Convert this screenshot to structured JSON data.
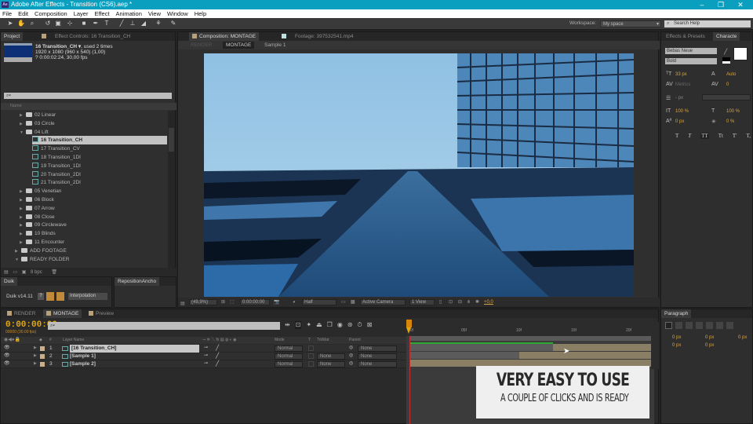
{
  "window": {
    "app_icon": "Ae",
    "title": "Adobe After Effects - Transition (CS6).aep *",
    "controls": {
      "minimize": "–",
      "restore": "❐",
      "close": "✕"
    }
  },
  "menu": [
    "File",
    "Edit",
    "Composition",
    "Layer",
    "Effect",
    "Animation",
    "View",
    "Window",
    "Help"
  ],
  "toolbar": {
    "tools": [
      "selection-tool",
      "hand-tool",
      "zoom-tool",
      "rotate-tool",
      "camera-tool",
      "pan-behind-tool",
      "mask-tool",
      "pen-tool",
      "type-tool",
      "brush-tool",
      "clone-stamp-tool",
      "eraser-tool",
      "roto-brush-tool",
      "puppet-pin-tool"
    ],
    "workspace_label": "Workspace:",
    "workspace_value": "My space",
    "search_placeholder": "Search Help"
  },
  "project": {
    "tabs": [
      "Project",
      "Effect Controls: 16 Transition_CH"
    ],
    "selected_item": {
      "name": "16 Transition_CH ▾",
      "usage": ", used 2 times",
      "resolution": "1920 x 1080  (960 x 540) (1,00)",
      "duration": "? 0:00:02:24, 30,00 fps"
    },
    "search_placeholder": "⌕▾",
    "column_header": "Name",
    "items": [
      {
        "label": "02 Linear",
        "type": "folder",
        "indent": 2,
        "expanded": false
      },
      {
        "label": "03 Circle",
        "type": "folder",
        "indent": 2,
        "expanded": false
      },
      {
        "label": "04 Lift",
        "type": "folder",
        "indent": 2,
        "expanded": true
      },
      {
        "label": "16 Transition_CH",
        "type": "comp",
        "indent": 3,
        "selected": true
      },
      {
        "label": "17 Transition_CV",
        "type": "comp",
        "indent": 3
      },
      {
        "label": "18 Transition_1DI",
        "type": "comp",
        "indent": 3
      },
      {
        "label": "19 Transition_1DI",
        "type": "comp",
        "indent": 3
      },
      {
        "label": "20 Transition_2DI",
        "type": "comp",
        "indent": 3
      },
      {
        "label": "21 Transition_2DI",
        "type": "comp",
        "indent": 3
      },
      {
        "label": "05 Venetian",
        "type": "folder",
        "indent": 2,
        "expanded": false
      },
      {
        "label": "06 Block",
        "type": "folder",
        "indent": 2,
        "expanded": false
      },
      {
        "label": "07 Arrow",
        "type": "folder",
        "indent": 2,
        "expanded": false
      },
      {
        "label": "08 Close",
        "type": "folder",
        "indent": 2,
        "expanded": false
      },
      {
        "label": "09 Circlewave",
        "type": "folder",
        "indent": 2,
        "expanded": false
      },
      {
        "label": "10 Blinds",
        "type": "folder",
        "indent": 2,
        "expanded": false
      },
      {
        "label": "11 Encounter",
        "type": "folder",
        "indent": 2,
        "expanded": false
      },
      {
        "label": "ADD FOOTAGE",
        "type": "folder",
        "indent": 1,
        "expanded": false
      },
      {
        "label": "READY FOLDER",
        "type": "folder",
        "indent": 1,
        "expanded": true
      }
    ],
    "bit_depth": "8 bpc"
  },
  "duik": {
    "tab": "Duik",
    "version": "Duik v14.11",
    "help": "?",
    "mode_select": "Interpolation"
  },
  "reposition": {
    "tab": "RepositionAncho"
  },
  "composition": {
    "tabs": [
      "Composition: MONTAGE",
      "Footage: 397532541.mp4"
    ],
    "breadcrumbs": [
      "RENDER",
      "MONTAGE",
      "Sample 1"
    ],
    "viewer_bar": {
      "magnification": "(49,9%)",
      "timecode": "0:00:00:00",
      "resolution": "Half",
      "camera": "Active Camera",
      "views": "1 View",
      "exposure": "+0,0"
    }
  },
  "character": {
    "tabs": [
      "Effects & Presets",
      "Characte"
    ],
    "font_family": "Bebas Neue",
    "font_style": "Bold",
    "font_size": "33 px",
    "leading": "Auto",
    "kerning": "Metrics",
    "tracking": "0",
    "stroke_width": "- px",
    "vertical_scale": "100 %",
    "horizontal_scale": "100 %",
    "baseline_shift": "0 px",
    "tsume": "0 %",
    "style_buttons": [
      "T",
      "T",
      "TT",
      "Tt",
      "T'",
      "T,"
    ]
  },
  "paragraph": {
    "tab": "Paragraph",
    "indent_values": [
      "0 px",
      "0 px",
      "0 px",
      "0 px",
      "0 px"
    ]
  },
  "timeline": {
    "tabs": [
      "RENDER",
      "MONTAGE",
      "Preview"
    ],
    "active_tab": "MONTAGE",
    "timecode": "0:00:00:00",
    "timecode_sub": "00000 (30.00 fps)",
    "search_placeholder": "⌕▾",
    "columns": [
      "Layer Name",
      "Mode",
      "T",
      "TrkMat",
      "Parent"
    ],
    "layers": [
      {
        "index": "1",
        "name": "[16 Transition_CH]",
        "mode": "Normal",
        "trkmat": "",
        "parent": "None",
        "selected": true
      },
      {
        "index": "2",
        "name": "[Sample 1]",
        "mode": "Normal",
        "trkmat": "None",
        "parent": "None"
      },
      {
        "index": "3",
        "name": "[Sample 2]",
        "mode": "Normal",
        "trkmat": "None",
        "parent": "None"
      }
    ],
    "ruler_ticks": [
      "00f",
      "05f",
      "10f",
      "15f",
      "20f"
    ],
    "colors": {
      "timecode": "#e3a60f",
      "work_area": "#2fa82f",
      "layer_bar": "#8a7e65",
      "playhead": "#c03030"
    }
  },
  "overlay": {
    "headline": "VERY EASY TO USE",
    "subline": "A COUPLE OF CLICKS AND IS READY"
  }
}
